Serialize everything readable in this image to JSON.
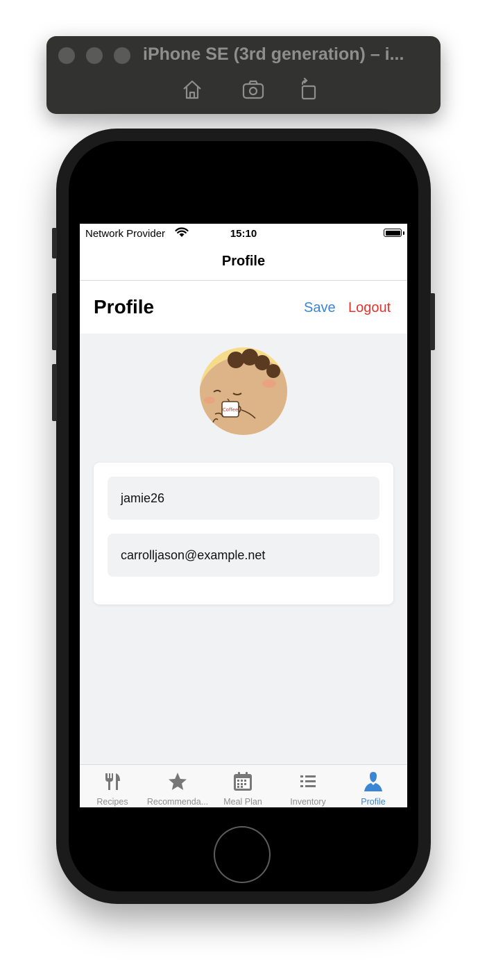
{
  "simulator": {
    "title": "iPhone SE (3rd generation) – i..."
  },
  "status_bar": {
    "carrier": "Network Provider",
    "time": "15:10"
  },
  "nav": {
    "title": "Profile"
  },
  "header": {
    "title": "Profile",
    "save_label": "Save",
    "logout_label": "Logout"
  },
  "profile": {
    "username": "jamie26",
    "email": "carrolljason@example.net",
    "avatar_mug_text": "Coffee"
  },
  "tabs": [
    {
      "label": "Recipes",
      "icon": "fork-knife-icon",
      "active": false
    },
    {
      "label": "Recommenda...",
      "icon": "star-icon",
      "active": false
    },
    {
      "label": "Meal Plan",
      "icon": "calendar-icon",
      "active": false
    },
    {
      "label": "Inventory",
      "icon": "list-icon",
      "active": false
    },
    {
      "label": "Profile",
      "icon": "person-icon",
      "active": true
    }
  ],
  "colors": {
    "accent": "#3a86d4",
    "danger": "#e3342f",
    "screen_background": "#f0f2f4"
  }
}
